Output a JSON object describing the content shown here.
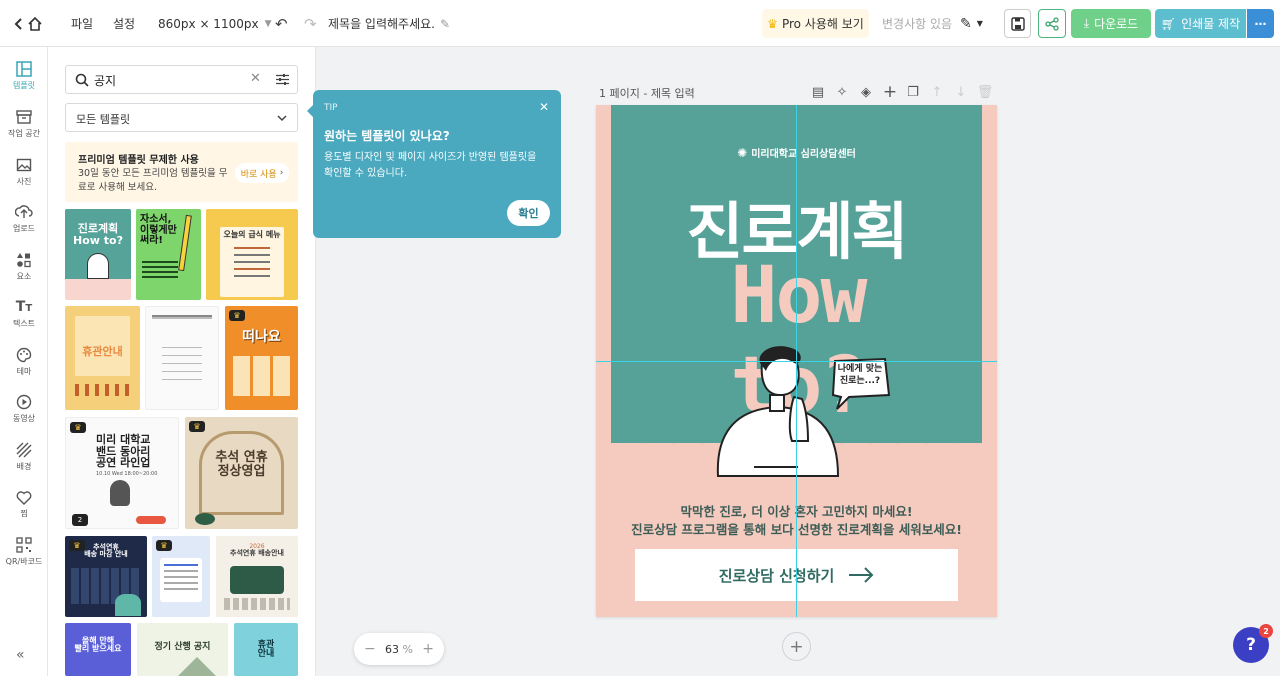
{
  "topbar": {
    "file": "파일",
    "settings": "설정",
    "size": "860px × 1100px",
    "title": "제목을 입력해주세요.",
    "pro": "Pro 사용해 보기",
    "no_changes": "변경사항 있음",
    "download": "다운로드",
    "print": "인쇄물 제작"
  },
  "nav": [
    {
      "label": "템플릿",
      "icon": "template-icon"
    },
    {
      "label": "작업 공간",
      "icon": "workspace-icon"
    },
    {
      "label": "사진",
      "icon": "photo-icon"
    },
    {
      "label": "업로드",
      "icon": "upload-icon"
    },
    {
      "label": "요소",
      "icon": "elements-icon"
    },
    {
      "label": "텍스트",
      "icon": "text-icon"
    },
    {
      "label": "테마",
      "icon": "palette-icon"
    },
    {
      "label": "동영상",
      "icon": "video-icon"
    },
    {
      "label": "배경",
      "icon": "background-icon"
    },
    {
      "label": "찜",
      "icon": "heart-icon"
    },
    {
      "label": "QR/바코드",
      "icon": "qr-icon"
    }
  ],
  "panel": {
    "search_value": "공지",
    "filter": "모든 템플릿",
    "promo_title": "프리미엄 템플릿 무제한 사용",
    "promo_text": "30일 동안 모든 프리미엄 템플릿을 무료로 사용해 보세요.",
    "promo_button": "바로 사용",
    "thumbs": {
      "t1": "진로계획\nHow to?",
      "t2": "자소서,\n이렇게만\n써라!",
      "t3": "오늘의 급식 메뉴",
      "t4": "휴관안내",
      "t6": "떠나요",
      "t7": "미리 대학교\n밴드 동아리\n공연 라인업",
      "t7b": "10.10 Wed 18:00~20:00",
      "t7badge": "2",
      "t8": "추석 연휴\n정상영업",
      "t9": "추석연휴\n배송 마감 안내",
      "t11": "추석연휴 배송안내",
      "t11y": "2026",
      "t12": "올해 만해\n빨리 받으세요",
      "t13": "정기 산행 공지",
      "t14": "휴관\n안내"
    }
  },
  "tip": {
    "label": "TIP",
    "title": "원하는 템플릿이 있나요?",
    "text": "용도별 디자인 및 페이지 사이즈가 반영된 템플릿을 확인할 수 있습니다.",
    "button": "확인"
  },
  "page": {
    "label": "1 페이지 - 제목 입력",
    "org": "미리대학교 심리상담센터",
    "headline": "진로계획",
    "howto": "How to?",
    "bubble": "나에게 맞는\n진로는...?",
    "line1": "막막한 진로, 더 이상 혼자 고민하지 마세요!",
    "line2": "진로상담 프로그램을 통해 보다 선명한 진로계획을 세워보세요!",
    "cta": "진로상담 신청하기"
  },
  "zoom": {
    "value": "63",
    "unit": "%"
  },
  "help_badge": "2",
  "colors": {
    "teal": "#55a298",
    "pink": "#f6cbbf",
    "accent": "#3aa6b9",
    "green": "#6fd08a",
    "tealbtn": "#5dbecf"
  }
}
